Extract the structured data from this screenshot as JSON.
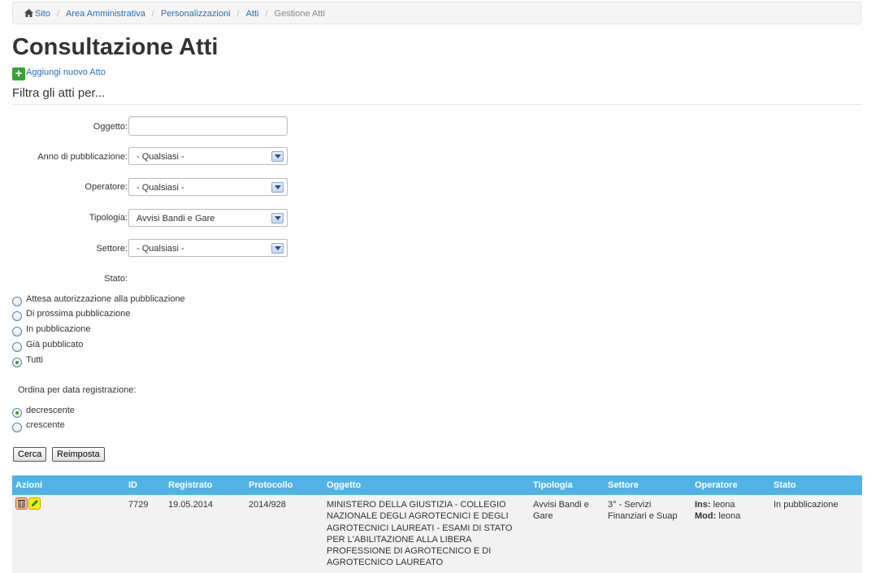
{
  "breadcrumb": {
    "items": [
      "Sito",
      "Area Amministrativa",
      "Personalizzazioni",
      "Atti"
    ],
    "current": "Gestione Atti",
    "separator": "/"
  },
  "page_title": "Consultazione Atti",
  "add_link": "Aggiungi nuovo Atto",
  "filter_title": "Filtra gli atti per...",
  "filters": {
    "oggetto": {
      "label": "Oggetto:",
      "value": ""
    },
    "anno": {
      "label": "Anno di pubblicazione:",
      "value": "- Qualsiasi -"
    },
    "operatore": {
      "label": "Operatore:",
      "value": "- Qualsiasi -"
    },
    "tipologia": {
      "label": "Tipologia:",
      "value": "Avvisi Bandi e Gare"
    },
    "settore": {
      "label": "Settore:",
      "value": "- Qualsiasi -"
    },
    "stato_label": "Stato:",
    "stato_options": [
      {
        "label": "Attesa autorizzazione alla pubblicazione",
        "checked": false
      },
      {
        "label": "Di prossima pubblicazione",
        "checked": false
      },
      {
        "label": "In pubblicazione",
        "checked": false
      },
      {
        "label": "Già pubblicato",
        "checked": false
      },
      {
        "label": "Tutti",
        "checked": true
      }
    ],
    "ordina_label": "Ordina per data registrazione:",
    "ordina_options": [
      {
        "label": "decrescente",
        "checked": true
      },
      {
        "label": "crescente",
        "checked": false
      }
    ]
  },
  "buttons": {
    "cerca": "Cerca",
    "reimposta": "Reimposta"
  },
  "table": {
    "headers": [
      "Azioni",
      "ID",
      "Registrato",
      "Protocollo",
      "Oggetto",
      "Tipologia",
      "Settore",
      "Operatore",
      "Stato"
    ],
    "rows": [
      {
        "id": "7729",
        "registrato": "19.05.2014",
        "protocollo": "2014/928",
        "oggetto": "MINISTERO DELLA GIUSTIZIA - COLLEGIO NAZIONALE DEGLI AGROTECNICI E DEGLI AGROTECNICI LAUREATI - ESAMI DI STATO PER L'ABILITAZIONE ALLA LIBERA PROFESSIONE DI AGROTECNICO E DI AGROTECNICO LAUREATO",
        "tipologia": "Avvisi Bandi e Gare",
        "settore": "3° - Servizi Finanziari e Suap",
        "ins_label": "Ins:",
        "ins_value": "leona",
        "mod_label": "Mod:",
        "mod_value": "leona",
        "stato": "In pubblicazione"
      }
    ]
  },
  "colors": {
    "table_header": "#4fb3e6",
    "link": "#2a6fb0",
    "add_icon": "#3aa335"
  }
}
